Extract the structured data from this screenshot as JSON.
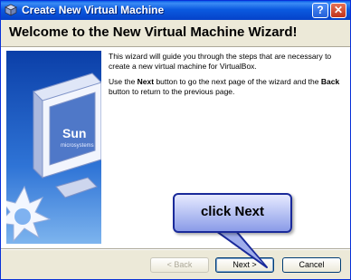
{
  "window": {
    "title": "Create New Virtual Machine",
    "help_symbol": "?",
    "close_symbol": "✕"
  },
  "header": {
    "title": "Welcome to the New Virtual Machine Wizard!"
  },
  "body": {
    "para1": "This wizard will guide you through the steps that are necessary to create a new virtual machine for VirtualBox.",
    "para2_a": "Use the ",
    "para2_next": "Next",
    "para2_b": " button to go the next page of the wizard and the ",
    "para2_back": "Back",
    "para2_c": " button to return to the previous page."
  },
  "side_art": {
    "logo_text": "Sun",
    "logo_sub": "microsystems"
  },
  "buttons": {
    "back": "< Back",
    "next": "Next >",
    "cancel": "Cancel"
  },
  "callout": {
    "text": "click Next"
  },
  "colors": {
    "titlebar": "#0a5ee8",
    "callout_border": "#1a2a9a",
    "dialog_bg": "#ece9d8"
  }
}
